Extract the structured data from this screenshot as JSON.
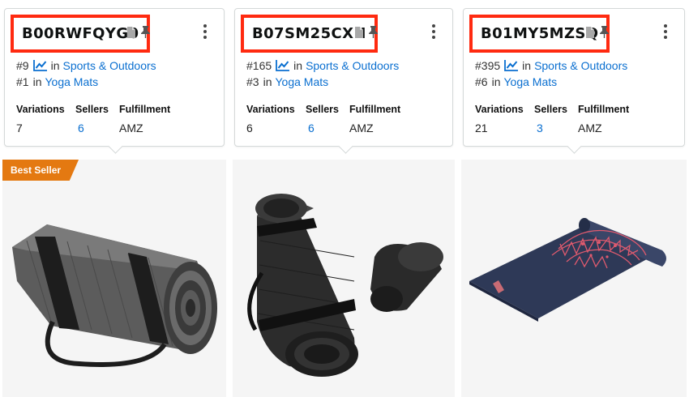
{
  "products": [
    {
      "asin": "B00RWFQYG0",
      "rank_main": "#9",
      "category_main": "Sports & Outdoors",
      "rank_sub": "#1",
      "category_sub": "Yoga Mats",
      "in_word": "in",
      "variations": "7",
      "sellers": "6",
      "fulfillment": "AMZ",
      "badge": "Best Seller",
      "image_icon": "gray-rolled-yoga-mat-image"
    },
    {
      "asin": "B07SM25CXH",
      "rank_main": "#165",
      "category_main": "Sports & Outdoors",
      "rank_sub": "#3",
      "category_sub": "Yoga Mats",
      "in_word": "in",
      "variations": "6",
      "sellers": "6",
      "fulfillment": "AMZ",
      "image_icon": "black-rolled-yoga-mat-image"
    },
    {
      "asin": "B01MY5MZSQ",
      "rank_main": "#395",
      "category_main": "Sports & Outdoors",
      "rank_sub": "#6",
      "category_sub": "Yoga Mats",
      "in_word": "in",
      "variations": "21",
      "sellers": "3",
      "fulfillment": "AMZ",
      "image_icon": "navy-mandala-yoga-mat-image"
    }
  ],
  "labels": {
    "variations": "Variations",
    "sellers": "Sellers",
    "fulfillment": "Fulfillment"
  },
  "colors": {
    "highlight_box": "#ff2a10",
    "link": "#0a6fd0",
    "badge": "#e47911"
  }
}
